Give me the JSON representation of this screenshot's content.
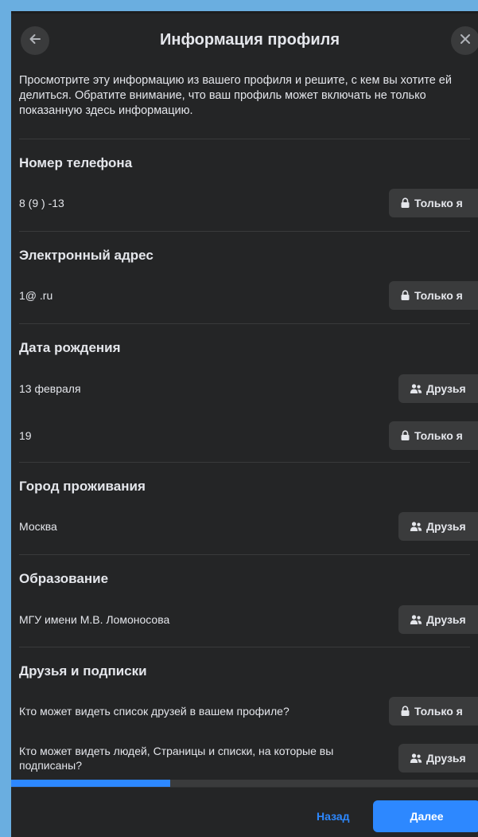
{
  "header": {
    "title": "Информация профиля",
    "back_icon": "arrow-left-icon",
    "close_icon": "close-icon"
  },
  "description": "Просмотрите эту информацию из вашего профиля и решите, с кем вы хотите ей делиться. Обратите внимание, что ваш профиль может включать не только показанную здесь информацию.",
  "sections": {
    "phone": {
      "title": "Номер телефона",
      "value": "8 (9   )          -13",
      "privacy": "Только я"
    },
    "email": {
      "title": "Электронный адрес",
      "value": "1@   .ru",
      "privacy": "Только я"
    },
    "birthday": {
      "title": "Дата рождения",
      "date_value": "13 февраля",
      "date_privacy": "Друзья",
      "year_value": "19",
      "year_privacy": "Только я"
    },
    "city": {
      "title": "Город проживания",
      "value": "Москва",
      "privacy": "Друзья"
    },
    "education": {
      "title": "Образование",
      "value": "МГУ имени М.В. Ломоносова",
      "privacy": "Друзья"
    },
    "friends": {
      "title": "Друзья и подписки",
      "q1": "Кто может видеть список друзей в вашем профиле?",
      "q1_privacy": "Только я",
      "q2": "Кто может видеть людей, Страницы и списки, на которые вы подписаны?",
      "q2_privacy": "Друзья"
    }
  },
  "progress": {
    "fraction": 0.34
  },
  "footer": {
    "back_label": "Назад",
    "next_label": "Далее"
  },
  "colors": {
    "background": "#242526",
    "accent": "#2d88ff",
    "button": "#3a3b3c",
    "frame": "#6aaee0"
  }
}
